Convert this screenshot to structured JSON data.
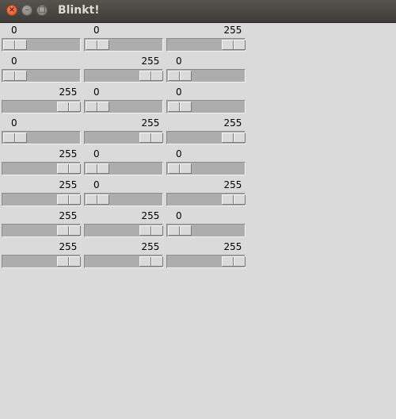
{
  "window": {
    "title": "Blinkt!",
    "controls": [
      "close-icon",
      "minimize-icon",
      "maximize-icon"
    ]
  },
  "slider_range": [
    0,
    255
  ],
  "rows": [
    [
      0,
      0,
      255
    ],
    [
      0,
      255,
      0
    ],
    [
      255,
      0,
      0
    ],
    [
      0,
      255,
      255
    ],
    [
      255,
      0,
      0
    ],
    [
      255,
      0,
      255
    ],
    [
      255,
      255,
      0
    ],
    [
      255,
      255,
      255
    ]
  ]
}
